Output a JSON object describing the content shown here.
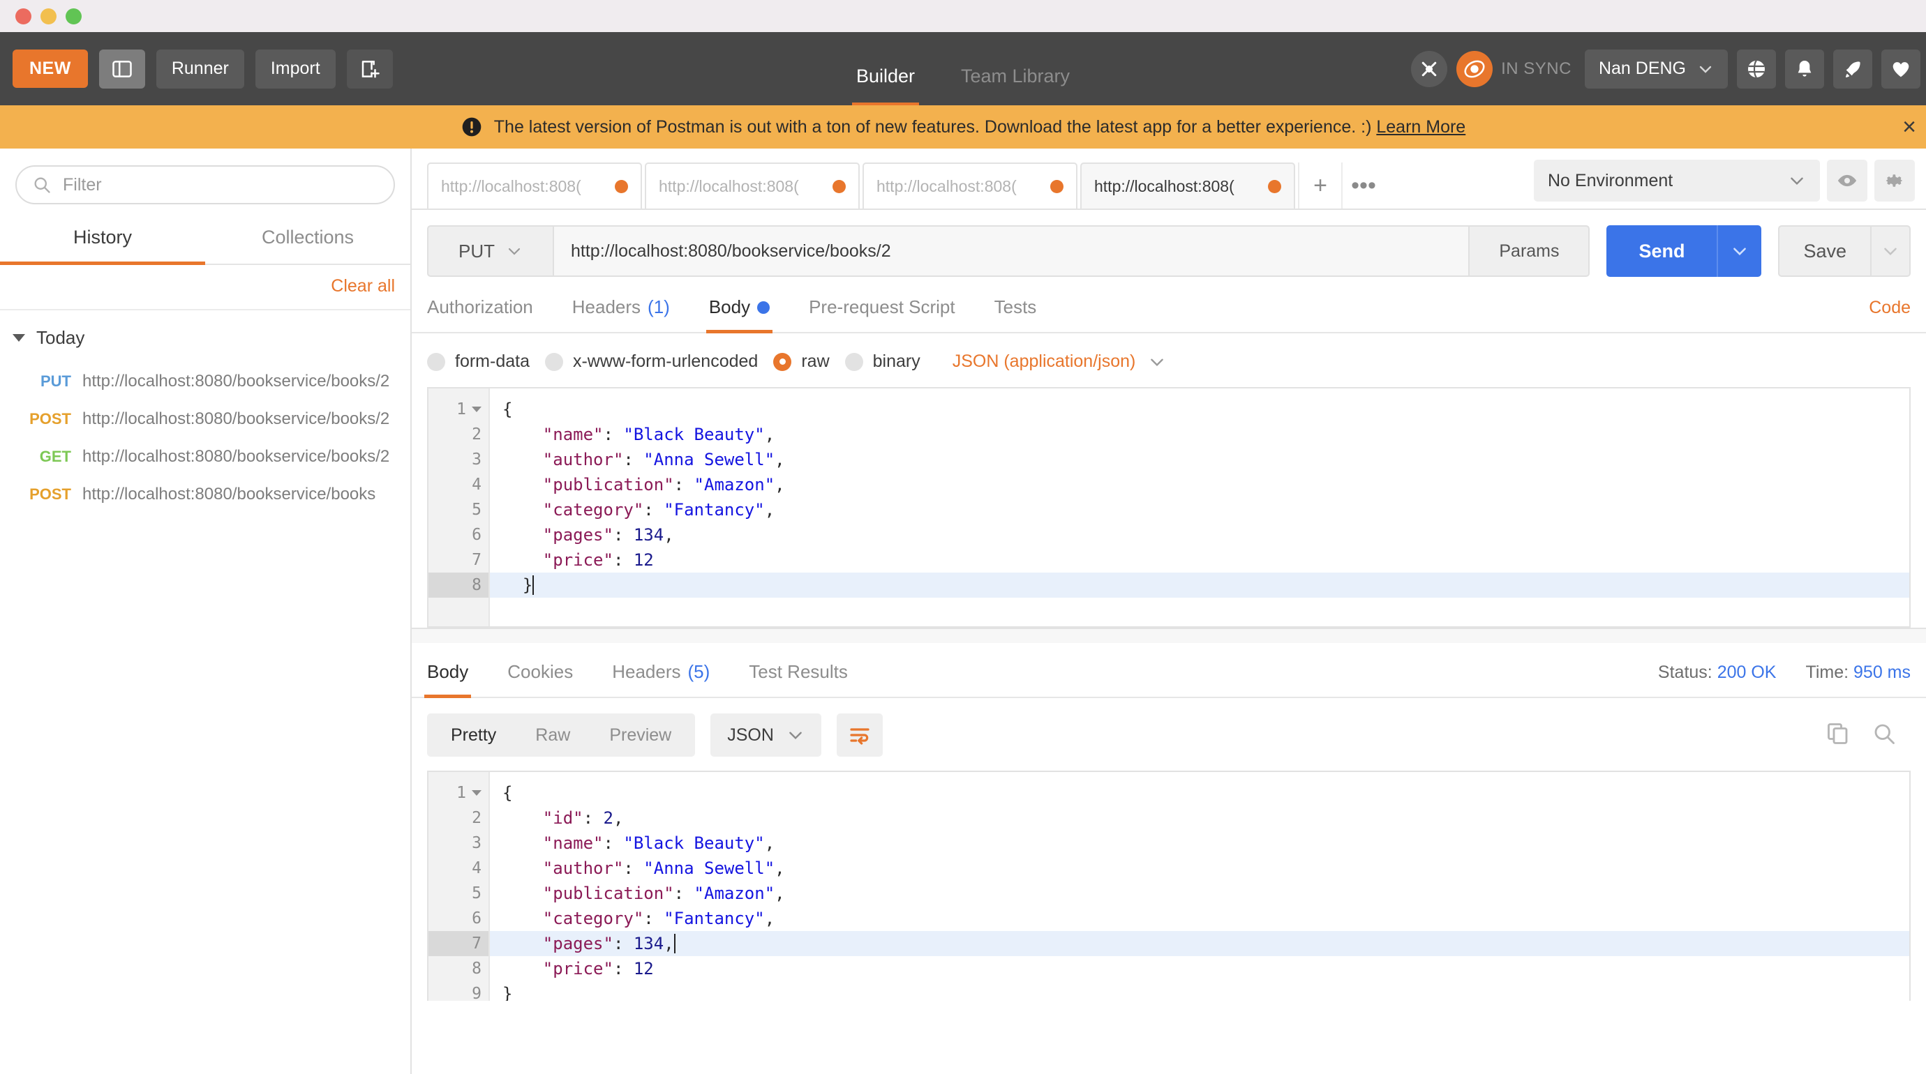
{
  "window": {
    "traffic_lights": [
      "close",
      "minimize",
      "maximize"
    ]
  },
  "header": {
    "new_button": "NEW",
    "sidebar_toggle_icon": "sidebar-layout-icon",
    "runner_button": "Runner",
    "import_button": "Import",
    "new_tab_icon": "new-window-icon",
    "tabs": [
      {
        "label": "Builder",
        "active": true
      },
      {
        "label": "Team Library",
        "active": false
      }
    ],
    "interceptor_icon": "interceptor-icon",
    "sync_icon": "postman-sync-icon",
    "sync_status": "IN SYNC",
    "user_name": "Nan DENG",
    "user_caret_icon": "chevron-down-icon",
    "globe_icon": "globe-icon",
    "bell_icon": "bell-icon",
    "rocket_icon": "rocket-icon",
    "heart_icon": "heart-icon"
  },
  "banner": {
    "alert_icon": "alert-circle-icon",
    "message": "The latest version of Postman is out with a ton of new features. Download the latest app for a better experience. :) ",
    "link_label": "Learn More",
    "close_label": "×",
    "bg_color": "#f3b14e"
  },
  "sidebar": {
    "filter_placeholder": "Filter",
    "search_icon": "search-icon",
    "tabs": [
      {
        "label": "History",
        "active": true
      },
      {
        "label": "Collections",
        "active": false
      }
    ],
    "clear_all": "Clear all",
    "group_label": "Today",
    "history": [
      {
        "method": "PUT",
        "url": "http://localhost:8080/bookservice/books/2",
        "color": "#5a9bd8"
      },
      {
        "method": "POST",
        "url": "http://localhost:8080/bookservice/books/2",
        "color": "#e5a02c"
      },
      {
        "method": "GET",
        "url": "http://localhost:8080/bookservice/books/2",
        "color": "#7dc855"
      },
      {
        "method": "POST",
        "url": "http://localhost:8080/bookservice/books",
        "color": "#e5a02c"
      }
    ]
  },
  "request_tabs": {
    "items": [
      {
        "label": "http://localhost:808(",
        "active": false,
        "unsaved": true
      },
      {
        "label": "http://localhost:808(",
        "active": false,
        "unsaved": true
      },
      {
        "label": "http://localhost:808(",
        "active": false,
        "unsaved": true
      },
      {
        "label": "http://localhost:808(",
        "active": true,
        "unsaved": true
      }
    ],
    "add_label": "+",
    "more_label": "•••"
  },
  "environment": {
    "selected": "No Environment",
    "caret_icon": "chevron-down-icon",
    "eye_icon": "eye-icon",
    "gear_icon": "gear-icon"
  },
  "url_bar": {
    "method": "PUT",
    "method_caret": "chevron-down-icon",
    "url": "http://localhost:8080/bookservice/books/2",
    "params_label": "Params",
    "send_label": "Send",
    "send_caret": "chevron-down-icon",
    "save_label": "Save",
    "save_caret": "chevron-down-icon",
    "send_color": "#3b74e8"
  },
  "request_panel": {
    "tabs": [
      {
        "label": "Authorization",
        "active": false,
        "count": ""
      },
      {
        "label": "Headers",
        "active": false,
        "count": "(1)"
      },
      {
        "label": "Body",
        "active": true,
        "count": "",
        "dot": true
      },
      {
        "label": "Pre-request Script",
        "active": false,
        "count": ""
      },
      {
        "label": "Tests",
        "active": false,
        "count": ""
      }
    ],
    "code_link": "Code",
    "body_types": [
      {
        "label": "form-data",
        "selected": false
      },
      {
        "label": "x-www-form-urlencoded",
        "selected": false
      },
      {
        "label": "raw",
        "selected": true
      },
      {
        "label": "binary",
        "selected": false
      }
    ],
    "content_type": "JSON (application/json)",
    "content_type_caret": "chevron-down-icon",
    "body_lines": [
      {
        "n": "1",
        "fold": true,
        "hl": false,
        "tokens": [
          {
            "t": "{",
            "c": "p"
          }
        ]
      },
      {
        "n": "2",
        "fold": false,
        "hl": false,
        "tokens": [
          {
            "t": "    \"name\"",
            "c": "k"
          },
          {
            "t": ": ",
            "c": "p"
          },
          {
            "t": "\"Black Beauty\"",
            "c": "s"
          },
          {
            "t": ",",
            "c": "p"
          }
        ]
      },
      {
        "n": "3",
        "fold": false,
        "hl": false,
        "tokens": [
          {
            "t": "    \"author\"",
            "c": "k"
          },
          {
            "t": ": ",
            "c": "p"
          },
          {
            "t": "\"Anna Sewell\"",
            "c": "s"
          },
          {
            "t": ",",
            "c": "p"
          }
        ]
      },
      {
        "n": "4",
        "fold": false,
        "hl": false,
        "tokens": [
          {
            "t": "    \"publication\"",
            "c": "k"
          },
          {
            "t": ": ",
            "c": "p"
          },
          {
            "t": "\"Amazon\"",
            "c": "s"
          },
          {
            "t": ",",
            "c": "p"
          }
        ]
      },
      {
        "n": "5",
        "fold": false,
        "hl": false,
        "tokens": [
          {
            "t": "    \"category\"",
            "c": "k"
          },
          {
            "t": ": ",
            "c": "p"
          },
          {
            "t": "\"Fantancy\"",
            "c": "s"
          },
          {
            "t": ",",
            "c": "p"
          }
        ]
      },
      {
        "n": "6",
        "fold": false,
        "hl": false,
        "tokens": [
          {
            "t": "    \"pages\"",
            "c": "k"
          },
          {
            "t": ": ",
            "c": "p"
          },
          {
            "t": "134",
            "c": "n"
          },
          {
            "t": ",",
            "c": "p"
          }
        ]
      },
      {
        "n": "7",
        "fold": false,
        "hl": false,
        "tokens": [
          {
            "t": "    \"price\"",
            "c": "k"
          },
          {
            "t": ": ",
            "c": "p"
          },
          {
            "t": "12",
            "c": "n"
          }
        ]
      },
      {
        "n": "8",
        "fold": false,
        "hl": true,
        "caret": true,
        "tokens": [
          {
            "t": "  }",
            "c": "p"
          }
        ]
      }
    ]
  },
  "response_panel": {
    "tabs": [
      {
        "label": "Body",
        "active": true,
        "count": ""
      },
      {
        "label": "Cookies",
        "active": false,
        "count": ""
      },
      {
        "label": "Headers",
        "active": false,
        "count": "(5)"
      },
      {
        "label": "Test Results",
        "active": false,
        "count": ""
      }
    ],
    "status_label": "Status:",
    "status_value": "200 OK",
    "time_label": "Time:",
    "time_value": "950 ms",
    "view_modes": [
      {
        "label": "Pretty",
        "active": true
      },
      {
        "label": "Raw",
        "active": false
      },
      {
        "label": "Preview",
        "active": false
      }
    ],
    "format": "JSON",
    "format_caret": "chevron-down-icon",
    "wrap_icon": "word-wrap-icon",
    "copy_icon": "copy-icon",
    "search_icon": "search-icon",
    "body_lines": [
      {
        "n": "1",
        "fold": true,
        "hl": false,
        "tokens": [
          {
            "t": "{",
            "c": "p"
          }
        ]
      },
      {
        "n": "2",
        "fold": false,
        "hl": false,
        "tokens": [
          {
            "t": "    \"id\"",
            "c": "k"
          },
          {
            "t": ": ",
            "c": "p"
          },
          {
            "t": "2",
            "c": "n"
          },
          {
            "t": ",",
            "c": "p"
          }
        ]
      },
      {
        "n": "3",
        "fold": false,
        "hl": false,
        "tokens": [
          {
            "t": "    \"name\"",
            "c": "k"
          },
          {
            "t": ": ",
            "c": "p"
          },
          {
            "t": "\"Black Beauty\"",
            "c": "s"
          },
          {
            "t": ",",
            "c": "p"
          }
        ]
      },
      {
        "n": "4",
        "fold": false,
        "hl": false,
        "tokens": [
          {
            "t": "    \"author\"",
            "c": "k"
          },
          {
            "t": ": ",
            "c": "p"
          },
          {
            "t": "\"Anna Sewell\"",
            "c": "s"
          },
          {
            "t": ",",
            "c": "p"
          }
        ]
      },
      {
        "n": "5",
        "fold": false,
        "hl": false,
        "tokens": [
          {
            "t": "    \"publication\"",
            "c": "k"
          },
          {
            "t": ": ",
            "c": "p"
          },
          {
            "t": "\"Amazon\"",
            "c": "s"
          },
          {
            "t": ",",
            "c": "p"
          }
        ]
      },
      {
        "n": "6",
        "fold": false,
        "hl": false,
        "tokens": [
          {
            "t": "    \"category\"",
            "c": "k"
          },
          {
            "t": ": ",
            "c": "p"
          },
          {
            "t": "\"Fantancy\"",
            "c": "s"
          },
          {
            "t": ",",
            "c": "p"
          }
        ]
      },
      {
        "n": "7",
        "fold": false,
        "hl": true,
        "caret": true,
        "tokens": [
          {
            "t": "    \"pages\"",
            "c": "k"
          },
          {
            "t": ": ",
            "c": "p"
          },
          {
            "t": "134",
            "c": "n"
          },
          {
            "t": ",",
            "c": "p"
          }
        ]
      },
      {
        "n": "8",
        "fold": false,
        "hl": false,
        "tokens": [
          {
            "t": "    \"price\"",
            "c": "k"
          },
          {
            "t": ": ",
            "c": "p"
          },
          {
            "t": "12",
            "c": "n"
          }
        ]
      },
      {
        "n": "9",
        "fold": false,
        "hl": false,
        "tokens": [
          {
            "t": "}",
            "c": "p"
          }
        ]
      }
    ]
  }
}
